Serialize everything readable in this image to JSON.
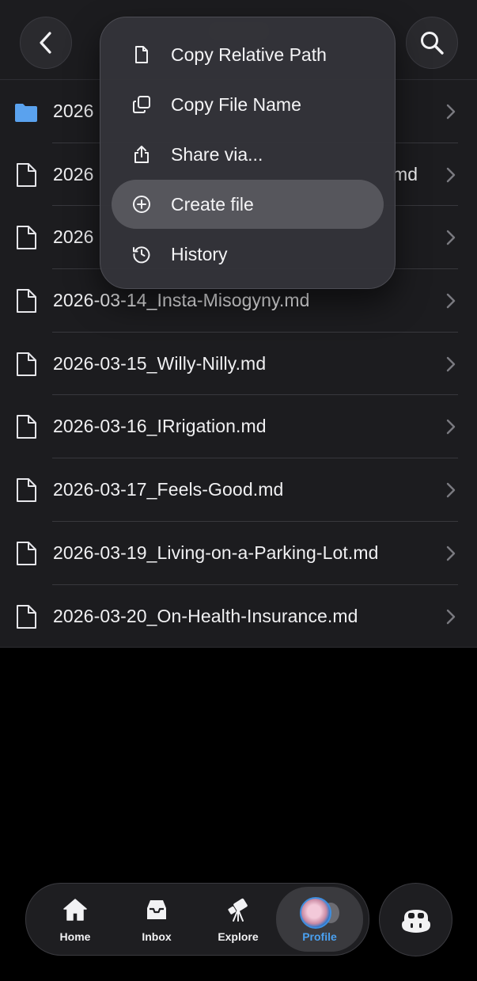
{
  "files": [
    {
      "name": "2026",
      "type": "folder"
    },
    {
      "name": "2026",
      "suffix": "md",
      "type": "file"
    },
    {
      "name": "2026",
      "type": "file"
    },
    {
      "name": "2026-03-14_Insta-Misogyny.md",
      "type": "file"
    },
    {
      "name": "2026-03-15_Willy-Nilly.md",
      "type": "file"
    },
    {
      "name": "2026-03-16_IRrigation.md",
      "type": "file"
    },
    {
      "name": "2026-03-17_Feels-Good.md",
      "type": "file"
    },
    {
      "name": "2026-03-19_Living-on-a-Parking-Lot.md",
      "type": "file"
    },
    {
      "name": "2026-03-20_On-Health-Insurance.md",
      "type": "file"
    }
  ],
  "menu": {
    "items": [
      {
        "label": "Copy Relative Path",
        "icon": "document-icon"
      },
      {
        "label": "Copy File Name",
        "icon": "copy-icon"
      },
      {
        "label": "Share via...",
        "icon": "share-icon"
      },
      {
        "label": "Create file",
        "icon": "plus-circle-icon",
        "highlighted": true
      },
      {
        "label": "History",
        "icon": "history-icon"
      }
    ]
  },
  "tabbar": {
    "tabs": [
      {
        "label": "Home",
        "icon": "home-icon"
      },
      {
        "label": "Inbox",
        "icon": "inbox-icon"
      },
      {
        "label": "Explore",
        "icon": "telescope-icon"
      },
      {
        "label": "Profile",
        "icon": "avatar",
        "active": true
      }
    ]
  },
  "colors": {
    "accent": "#4aa0f0",
    "folder": "#5aa2ee",
    "surface": "#1c1c1f"
  }
}
